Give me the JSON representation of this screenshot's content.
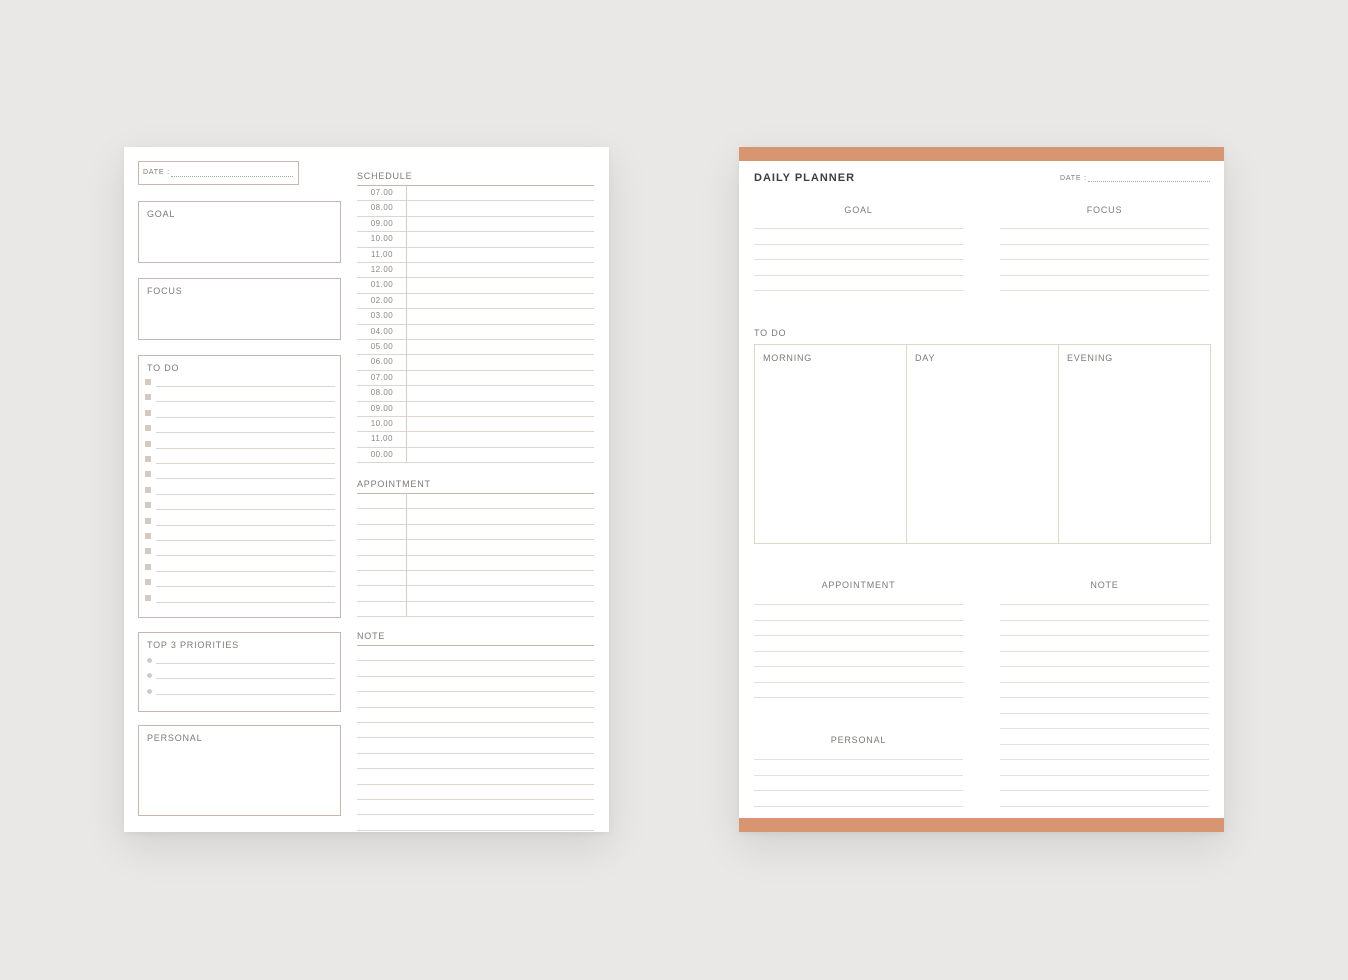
{
  "left_page": {
    "date_label": "DATE :",
    "goal_label": "GOAL",
    "focus_label": "FOCUS",
    "todo_label": "TO DO",
    "todo_item_count": 15,
    "priorities_label": "TOP 3 PRIORITIES",
    "priority_count": 3,
    "personal_label": "PERSONAL",
    "schedule_label": "SCHEDULE",
    "schedule_times": [
      "07.00",
      "08.00",
      "09.00",
      "10.00",
      "11.00",
      "12.00",
      "01.00",
      "02.00",
      "03.00",
      "04.00",
      "05.00",
      "06.00",
      "07.00",
      "08.00",
      "09.00",
      "10.00",
      "11.00",
      "00.00"
    ],
    "appointment_label": "APPOINTMENT",
    "appointment_rows": 8,
    "note_label": "NOTE",
    "note_lines": 12
  },
  "right_page": {
    "title": "DAILY PLANNER",
    "date_label": "DATE :",
    "goal_label": "GOAL",
    "focus_label": "FOCUS",
    "goal_lines": 5,
    "focus_lines": 5,
    "todo_label": "TO DO",
    "todo_columns": [
      "MORNING",
      "DAY",
      "EVENING"
    ],
    "appointment_label": "APPOINTMENT",
    "appointment_lines": 7,
    "note_label": "NOTE",
    "note_lines": 14,
    "personal_label": "PERSONAL",
    "personal_lines": 4
  },
  "colors": {
    "accent": "#d89572",
    "background": "#e9e8e6",
    "border": "#c9b7ad",
    "checkbox": "#d3cbc3"
  }
}
